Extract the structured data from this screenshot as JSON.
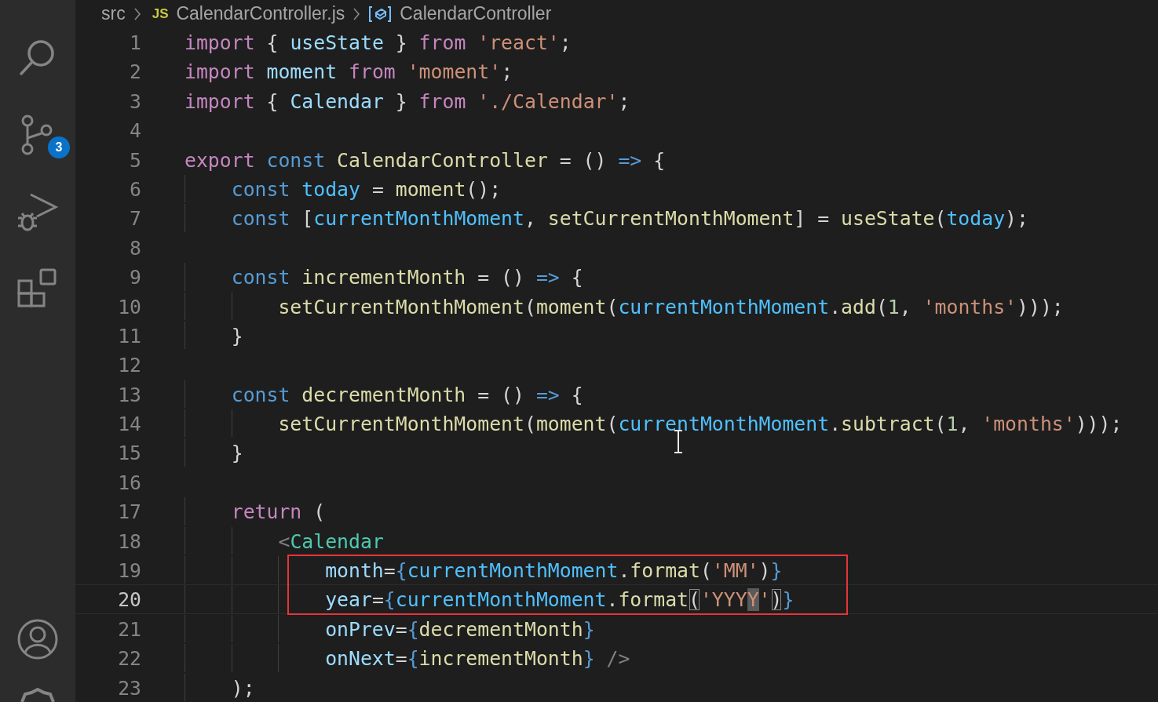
{
  "breadcrumb": {
    "folder": "src",
    "file_badge": "JS",
    "file": "CalendarController.js",
    "symbol": "CalendarController"
  },
  "activity_bar": {
    "source_control_badge": "3"
  },
  "editor": {
    "lines": [
      {
        "number": "1",
        "current": false,
        "boxed": false,
        "tokens": [
          {
            "text": "import",
            "kind": "kw"
          },
          {
            "text": " { ",
            "kind": "punc"
          },
          {
            "text": "useState",
            "kind": "var"
          },
          {
            "text": " } ",
            "kind": "punc"
          },
          {
            "text": "from ",
            "kind": "kw"
          },
          {
            "text": "'react'",
            "kind": "str"
          },
          {
            "text": ";",
            "kind": "punc"
          }
        ]
      },
      {
        "number": "2",
        "current": false,
        "boxed": false,
        "tokens": [
          {
            "text": "import ",
            "kind": "kw"
          },
          {
            "text": "moment ",
            "kind": "var"
          },
          {
            "text": "from ",
            "kind": "kw"
          },
          {
            "text": "'moment'",
            "kind": "str"
          },
          {
            "text": ";",
            "kind": "punc"
          }
        ]
      },
      {
        "number": "3",
        "current": false,
        "boxed": false,
        "tokens": [
          {
            "text": "import",
            "kind": "kw"
          },
          {
            "text": " { ",
            "kind": "punc"
          },
          {
            "text": "Calendar",
            "kind": "var"
          },
          {
            "text": " } ",
            "kind": "punc"
          },
          {
            "text": "from ",
            "kind": "kw"
          },
          {
            "text": "'./Calendar'",
            "kind": "str"
          },
          {
            "text": ";",
            "kind": "punc"
          }
        ]
      },
      {
        "number": "4",
        "current": false,
        "boxed": false
      },
      {
        "number": "5",
        "current": false,
        "boxed": false,
        "tokens": [
          {
            "text": "export ",
            "kind": "kw"
          },
          {
            "text": "const ",
            "kind": "storage"
          },
          {
            "text": "CalendarController",
            "kind": "fn"
          },
          {
            "text": " = () ",
            "kind": "punc"
          },
          {
            "text": "=>",
            "kind": "storage"
          },
          {
            "text": " {",
            "kind": "punc"
          }
        ]
      },
      {
        "number": "6",
        "current": false,
        "boxed": false,
        "tokens": [
          {
            "text": "    const ",
            "kind": "storage"
          },
          {
            "text": "today",
            "kind": "const"
          },
          {
            "text": " = ",
            "kind": "punc"
          },
          {
            "text": "moment",
            "kind": "fn"
          },
          {
            "text": "();",
            "kind": "punc"
          }
        ]
      },
      {
        "number": "7",
        "current": false,
        "boxed": false,
        "tokens": [
          {
            "text": "    const",
            "kind": "storage"
          },
          {
            "text": " [",
            "kind": "punc"
          },
          {
            "text": "currentMonthMoment",
            "kind": "const"
          },
          {
            "text": ", ",
            "kind": "punc"
          },
          {
            "text": "setCurrentMonthMoment",
            "kind": "fn"
          },
          {
            "text": "] = ",
            "kind": "punc"
          },
          {
            "text": "useState",
            "kind": "fn"
          },
          {
            "text": "(",
            "kind": "punc"
          },
          {
            "text": "today",
            "kind": "const"
          },
          {
            "text": ");",
            "kind": "punc"
          }
        ]
      },
      {
        "number": "8",
        "current": false,
        "boxed": false
      },
      {
        "number": "9",
        "current": false,
        "boxed": false,
        "tokens": [
          {
            "text": "    const ",
            "kind": "storage"
          },
          {
            "text": "incrementMonth",
            "kind": "fn"
          },
          {
            "text": " = () ",
            "kind": "punc"
          },
          {
            "text": "=>",
            "kind": "storage"
          },
          {
            "text": " {",
            "kind": "punc"
          }
        ]
      },
      {
        "number": "10",
        "current": false,
        "boxed": false,
        "tokens": [
          {
            "text": "        setCurrentMonthMoment",
            "kind": "fn"
          },
          {
            "text": "(",
            "kind": "punc"
          },
          {
            "text": "moment",
            "kind": "fn"
          },
          {
            "text": "(",
            "kind": "punc"
          },
          {
            "text": "currentMonthMoment",
            "kind": "const"
          },
          {
            "text": ".",
            "kind": "punc"
          },
          {
            "text": "add",
            "kind": "fn"
          },
          {
            "text": "(",
            "kind": "punc"
          },
          {
            "text": "1",
            "kind": "num"
          },
          {
            "text": ", ",
            "kind": "punc"
          },
          {
            "text": "'months'",
            "kind": "str"
          },
          {
            "text": ")));",
            "kind": "punc"
          }
        ]
      },
      {
        "number": "11",
        "current": false,
        "boxed": false,
        "tokens": [
          {
            "text": "    }",
            "kind": "punc"
          }
        ]
      },
      {
        "number": "12",
        "current": false,
        "boxed": false
      },
      {
        "number": "13",
        "current": false,
        "boxed": false,
        "tokens": [
          {
            "text": "    const ",
            "kind": "storage"
          },
          {
            "text": "decrementMonth",
            "kind": "fn"
          },
          {
            "text": " = () ",
            "kind": "punc"
          },
          {
            "text": "=>",
            "kind": "storage"
          },
          {
            "text": " {",
            "kind": "punc"
          }
        ]
      },
      {
        "number": "14",
        "current": false,
        "boxed": false,
        "tokens": [
          {
            "text": "        setCurrentMonthMoment",
            "kind": "fn"
          },
          {
            "text": "(",
            "kind": "punc"
          },
          {
            "text": "moment",
            "kind": "fn"
          },
          {
            "text": "(",
            "kind": "punc"
          },
          {
            "text": "currentMonthMoment",
            "kind": "const"
          },
          {
            "text": ".",
            "kind": "punc"
          },
          {
            "text": "subtract",
            "kind": "fn"
          },
          {
            "text": "(",
            "kind": "punc"
          },
          {
            "text": "1",
            "kind": "num"
          },
          {
            "text": ", ",
            "kind": "punc"
          },
          {
            "text": "'months'",
            "kind": "str"
          },
          {
            "text": ")));",
            "kind": "punc"
          }
        ]
      },
      {
        "number": "15",
        "current": false,
        "boxed": false,
        "tokens": [
          {
            "text": "    }",
            "kind": "punc"
          }
        ]
      },
      {
        "number": "16",
        "current": false,
        "boxed": false
      },
      {
        "number": "17",
        "current": false,
        "boxed": false,
        "tokens": [
          {
            "text": "    return",
            "kind": "kw"
          },
          {
            "text": " (",
            "kind": "punc"
          }
        ]
      },
      {
        "number": "18",
        "current": false,
        "boxed": false,
        "tokens": [
          {
            "text": "        <",
            "kind": "tagpunc"
          },
          {
            "text": "Calendar",
            "kind": "tag"
          }
        ]
      },
      {
        "number": "19",
        "current": false,
        "boxed": true,
        "tokens": [
          {
            "text": "            month",
            "kind": "var"
          },
          {
            "text": "=",
            "kind": "punc"
          },
          {
            "text": "{",
            "kind": "storage"
          },
          {
            "text": "currentMonthMoment",
            "kind": "const"
          },
          {
            "text": ".",
            "kind": "punc"
          },
          {
            "text": "format",
            "kind": "fn"
          },
          {
            "text": "(",
            "kind": "punc"
          },
          {
            "text": "'MM'",
            "kind": "str"
          },
          {
            "text": ")",
            "kind": "punc"
          },
          {
            "text": "}",
            "kind": "storage"
          }
        ]
      },
      {
        "number": "20",
        "current": true,
        "boxed": true,
        "tokens": [
          {
            "text": "            year",
            "kind": "var"
          },
          {
            "text": "=",
            "kind": "punc"
          },
          {
            "text": "{",
            "kind": "storage"
          },
          {
            "text": "currentMonthMoment",
            "kind": "const"
          },
          {
            "text": ".",
            "kind": "punc"
          },
          {
            "text": "format",
            "kind": "fn"
          },
          {
            "text": "(",
            "kind": "bracket"
          },
          {
            "text": "'YYY",
            "kind": "str"
          },
          {
            "text": "Y",
            "kind": "strsel"
          },
          {
            "text": "'",
            "kind": "str"
          },
          {
            "text": ")",
            "kind": "bracket"
          },
          {
            "text": "}",
            "kind": "storage"
          }
        ]
      },
      {
        "number": "21",
        "current": false,
        "boxed": false,
        "tokens": [
          {
            "text": "            onPrev",
            "kind": "var"
          },
          {
            "text": "=",
            "kind": "punc"
          },
          {
            "text": "{",
            "kind": "storage"
          },
          {
            "text": "decrementMonth",
            "kind": "fn"
          },
          {
            "text": "}",
            "kind": "storage"
          }
        ]
      },
      {
        "number": "22",
        "current": false,
        "boxed": false,
        "tokens": [
          {
            "text": "            onNext",
            "kind": "var"
          },
          {
            "text": "=",
            "kind": "punc"
          },
          {
            "text": "{",
            "kind": "storage"
          },
          {
            "text": "incrementMonth",
            "kind": "fn"
          },
          {
            "text": "} ",
            "kind": "storage"
          },
          {
            "text": "/>",
            "kind": "tagpunc"
          }
        ]
      },
      {
        "number": "23",
        "current": false,
        "boxed": false,
        "tokens": [
          {
            "text": "    );",
            "kind": "punc"
          }
        ]
      }
    ]
  }
}
